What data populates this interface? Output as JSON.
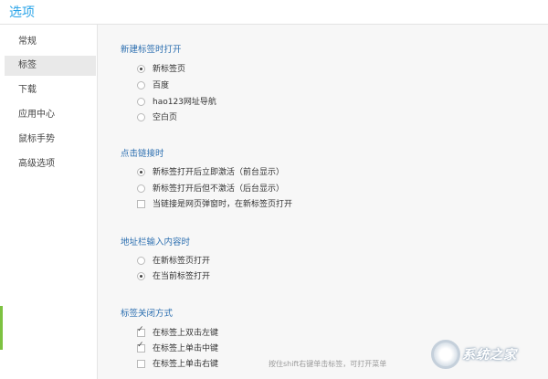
{
  "window": {
    "title": "选项"
  },
  "sidebar": {
    "items": [
      {
        "label": "常规",
        "active": false
      },
      {
        "label": "标签",
        "active": true
      },
      {
        "label": "下载",
        "active": false
      },
      {
        "label": "应用中心",
        "active": false
      },
      {
        "label": "鼠标手势",
        "active": false
      },
      {
        "label": "高级选项",
        "active": false
      }
    ]
  },
  "sections": {
    "new_tab": {
      "title": "新建标签时打开",
      "options": [
        {
          "label": "新标签页",
          "checked": true
        },
        {
          "label": "百度",
          "checked": false
        },
        {
          "label": "hao123网址导航",
          "checked": false
        },
        {
          "label": "空白页",
          "checked": false
        }
      ]
    },
    "click_link": {
      "title": "点击链接时",
      "options": [
        {
          "label": "新标签打开后立即激活（前台显示）",
          "checked": true
        },
        {
          "label": "新标签打开后但不激活（后台显示）",
          "checked": false
        }
      ],
      "checkbox": {
        "label": "当链接是网页弹窗时，在新标签页打开",
        "checked": false
      }
    },
    "address_bar": {
      "title": "地址栏输入内容时",
      "options": [
        {
          "label": "在新标签页打开",
          "checked": false
        },
        {
          "label": "在当前标签打开",
          "checked": true
        }
      ]
    },
    "close_tab": {
      "title": "标签关闭方式",
      "checkboxes": [
        {
          "label": "在标签上双击左键",
          "checked": true
        },
        {
          "label": "在标签上单击中键",
          "checked": true
        },
        {
          "label": "在标签上单击右键",
          "checked": false,
          "hint": "按住shift右键单击标签，可打开菜单"
        }
      ]
    }
  },
  "watermark": {
    "text": "系统之家"
  },
  "colors": {
    "accent": "#2aa4e8",
    "section_title": "#2c6fb0",
    "sidebar_active": "#e9e9e9"
  }
}
